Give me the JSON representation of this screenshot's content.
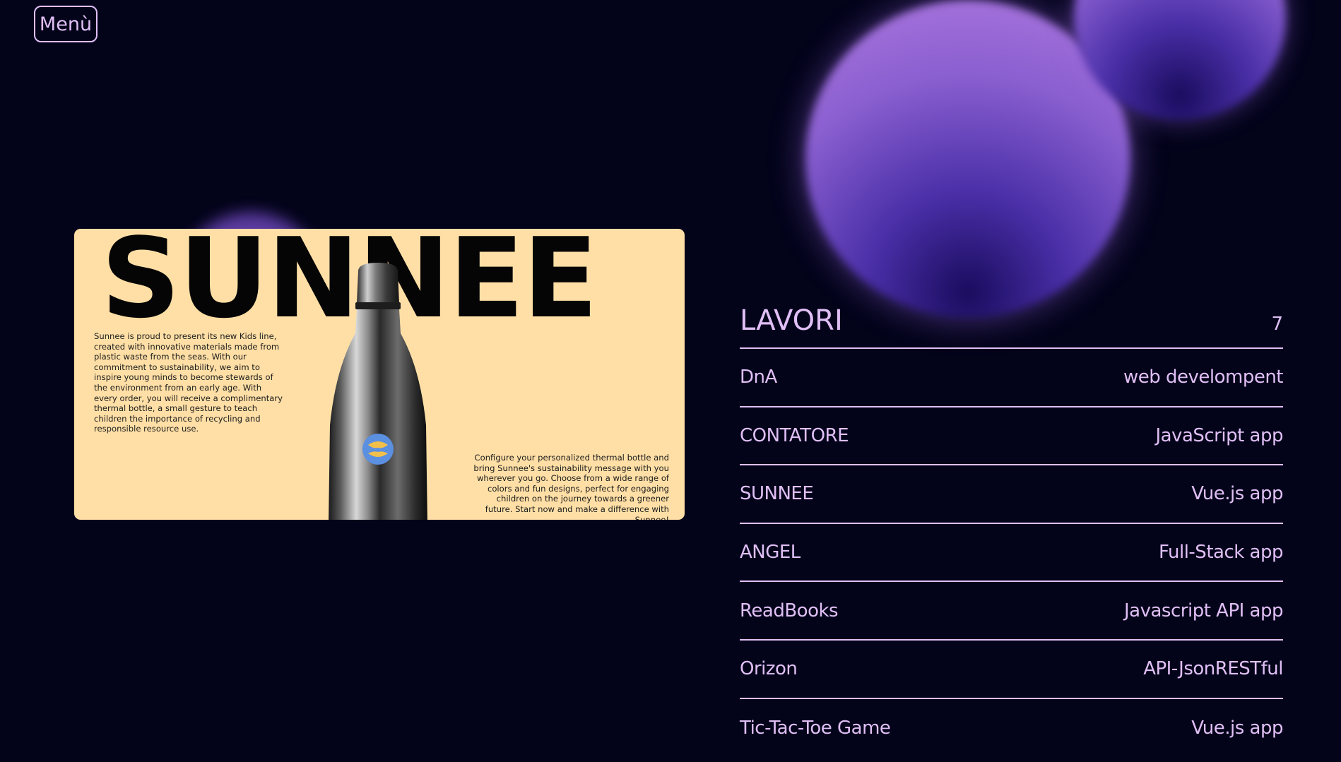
{
  "menu": {
    "label": "Menù"
  },
  "project_card": {
    "title": "SUNNEE",
    "description_left": "Sunnee is proud to present its new Kids line, created with innovative materials made from plastic waste from the seas. With our commitment to sustainability, we aim to inspire young minds to become stewards of the environment from an early age. With every order, you will receive a complimentary thermal bottle, a small gesture to teach children the importance of recycling and responsible resource use.",
    "description_right": "Configure your personalized thermal bottle and bring Sunnee's sustainability message with you wherever you go. Choose from a wide range of colors and fun designs, perfect for engaging children on the journey towards a greener future. Start now and make a difference with Sunnee!",
    "background_color": "#ffdfa6"
  },
  "works": {
    "title": "LAVORI",
    "count": "7",
    "items": [
      {
        "name": "DnA",
        "type": "web develompent"
      },
      {
        "name": "CONTATORE",
        "type": "JavaScript app"
      },
      {
        "name": "SUNNEE",
        "type": "Vue.js app"
      },
      {
        "name": "ANGEL",
        "type": "Full-Stack app"
      },
      {
        "name": "ReadBooks",
        "type": "Javascript API app"
      },
      {
        "name": "Orizon",
        "type": "API-JsonRESTful"
      },
      {
        "name": "Tic-Tac-Toe Game",
        "type": "Vue.js app"
      }
    ]
  },
  "colors": {
    "background": "#03031a",
    "accent": "#e0bff5",
    "orb": "#8a5fd0"
  }
}
